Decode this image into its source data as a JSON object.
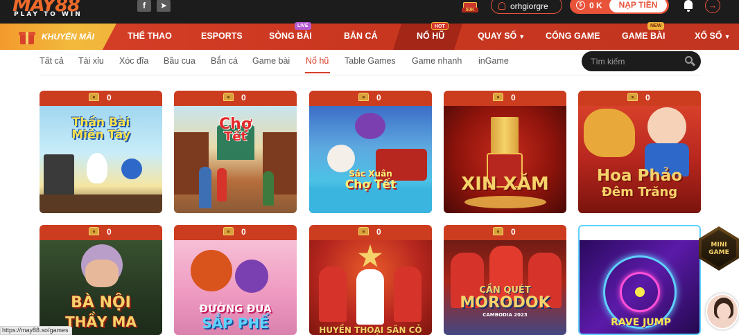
{
  "header": {
    "logo_text": "MAY88",
    "logo_tagline": "PLAY TO WIN",
    "facebook_icon": "facebook-icon",
    "telegram_icon": "telegram-icon",
    "gift_amount": "50K",
    "username": "orhgiorgre",
    "balance": "0 K",
    "deposit_label": "NẠP TIỀN",
    "bell_icon": "bell-icon",
    "logout_icon": "logout-icon"
  },
  "nav": {
    "promo_label": "KHUYẾN MÃI",
    "items": [
      {
        "label": "THỂ THAO"
      },
      {
        "label": "ESPORTS"
      },
      {
        "label": "SÒNG BÀI",
        "badge": "LIVE"
      },
      {
        "label": "BẮN CÁ"
      },
      {
        "label": "NỔ HŨ",
        "badge": "HOT"
      },
      {
        "label": "QUAY SỐ"
      },
      {
        "label": "CỔNG GAME"
      },
      {
        "label": "GAME BÀI",
        "badge": "NEW"
      },
      {
        "label": "XỔ SỐ"
      }
    ]
  },
  "subnav": {
    "tabs": [
      "Tất cả",
      "Tài xỉu",
      "Xóc đĩa",
      "Bầu cua",
      "Bắn cá",
      "Game bài",
      "Nổ hũ",
      "Table Games",
      "Game nhanh",
      "inGame"
    ],
    "active_tab": "Nổ hũ",
    "search_placeholder": "Tìm kiếm"
  },
  "games": [
    {
      "jackpot": "0",
      "title_top": "Thần Bài",
      "title_bottom": "Miền Tây"
    },
    {
      "jackpot": "0",
      "title_top": "Chợ",
      "title_bottom": "Tết"
    },
    {
      "jackpot": "0",
      "title_top": "Sắc Xuân",
      "title_bottom": "Chợ Tết"
    },
    {
      "jackpot": "0",
      "title_top": "XIN XĂM",
      "title_bottom": ""
    },
    {
      "jackpot": "0",
      "title_top": "Hoa Phảo",
      "title_bottom": "Đêm Trăng"
    },
    {
      "jackpot": "0",
      "title_top": "BÀ NỘI",
      "title_bottom": "THẦY MA"
    },
    {
      "jackpot": "0",
      "title_top": "ĐƯỜNG ĐUA",
      "title_bottom": "SẮP PHẾ"
    },
    {
      "jackpot": "0",
      "title_top": "HUYỀN THOẠI SÂN CỎ",
      "title_bottom": ""
    },
    {
      "jackpot": "0",
      "title_top": "CẦN QUÉT",
      "title_bottom": "MORODOK",
      "title_extra": "CAMBODIA 2023"
    },
    {
      "jackpot": "0",
      "title_top": "RAVE JUMP",
      "title_bottom": ""
    }
  ],
  "floating": {
    "mini_game_label": "MINI GAME"
  },
  "status_url": "https://may88.so/games",
  "colors": {
    "brand_orange": "#e8533a",
    "nav_red": "#d8412a",
    "header_dark": "#1c1c1c",
    "promo_gold": "#f2b93d"
  }
}
